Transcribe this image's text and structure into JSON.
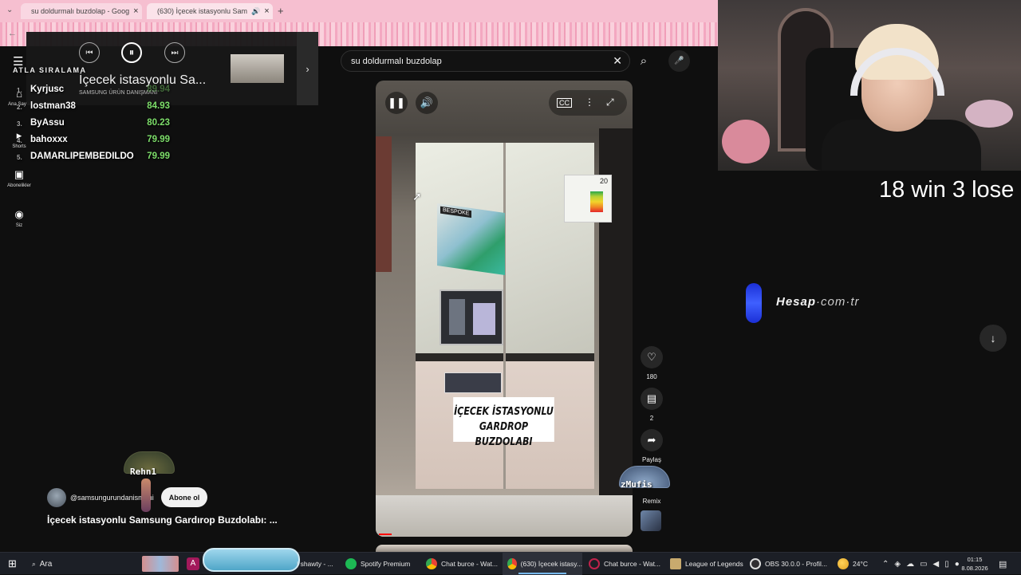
{
  "browser": {
    "tabs": [
      {
        "title": "su doldurmalı buzdolap - Goog",
        "icon": "google-icon"
      },
      {
        "title": "(630) İçecek istasyonlu Sam",
        "icon": "youtube-icon"
      }
    ],
    "new_tab": "+",
    "close": "×"
  },
  "sidebar": {
    "items": [
      {
        "label": "Ana Sayfa",
        "icon": "home-icon"
      },
      {
        "label": "Shorts",
        "icon": "shorts-icon"
      },
      {
        "label": "Abonelikler",
        "icon": "subscriptions-icon"
      },
      {
        "label": "Siz",
        "icon": "user-icon"
      }
    ]
  },
  "leaderboard": {
    "title": "ATLA SIRALAMA",
    "rows": [
      {
        "rank": "1.",
        "name": "Kyrjusc",
        "score": "89.94"
      },
      {
        "rank": "2.",
        "name": "lostman38",
        "score": "84.93"
      },
      {
        "rank": "3.",
        "name": "ByAssu",
        "score": "80.23"
      },
      {
        "rank": "4.",
        "name": "bahoxxx",
        "score": "79.99"
      },
      {
        "rank": "5.",
        "name": "DAMARLIPEMBEDILDO",
        "score": "79.99"
      }
    ]
  },
  "mini_player": {
    "title": "İçecek istasyonlu Sa...",
    "channel": "SAMSUNG ÜRÜN DANIŞMANI",
    "prev": "⏮",
    "pause": "⏸",
    "next": "⏭",
    "expand": "›"
  },
  "search": {
    "query": "su doldurmalı buzdolap",
    "clear": "✕",
    "search_icon": "⌕",
    "mic_icon": "🎤"
  },
  "video": {
    "caption_line1": "İÇECEK İSTASYONLU",
    "caption_line2": "GARDROP BUZDOLABI",
    "sticker_text": "BESPOKE",
    "energy_label": "20"
  },
  "actions": {
    "like_count": "180",
    "comment_count": "2",
    "share_label": "Paylaş",
    "remix_label": "Remix"
  },
  "channel": {
    "handle": "@samsungurundanismani",
    "subscribe": "Abone ol",
    "title": "İçecek istasyonlu Samsung Gardırop Buzdolabı: ..."
  },
  "overlays": {
    "para1": "Rehn1",
    "para2": "zMufis"
  },
  "stream": {
    "record": "18 win 3 lose",
    "sponsor_main": "Hesap",
    "sponsor_dot1": "·",
    "sponsor_com": "com",
    "sponsor_dot2": "·",
    "sponsor_tr": "tr"
  },
  "taskbar": {
    "search": "Ara",
    "items": [
      {
        "label": "| shawty - ...",
        "icon_color": "#2b2b2b"
      },
      {
        "label": "Spotify Premium",
        "icon_color": "#1db954"
      },
      {
        "label": "Chat burce - Wat...",
        "icon_color": "#e94335"
      },
      {
        "label": "(630) İçecek istasy...",
        "icon_color": "#e94335"
      },
      {
        "label": "Chat burce - Wat...",
        "icon_color": "#7a1f3d"
      },
      {
        "label": "League of Legends",
        "icon_color": "#c8aa6e"
      },
      {
        "label": "OBS 30.0.0 - Profil...",
        "icon_color": "#302e31"
      }
    ],
    "temperature": "24°C",
    "time": "01:15",
    "date": "8.08.2026",
    "colors": {
      "accent": "#76b9ed",
      "bar": "#1c1f26"
    }
  }
}
